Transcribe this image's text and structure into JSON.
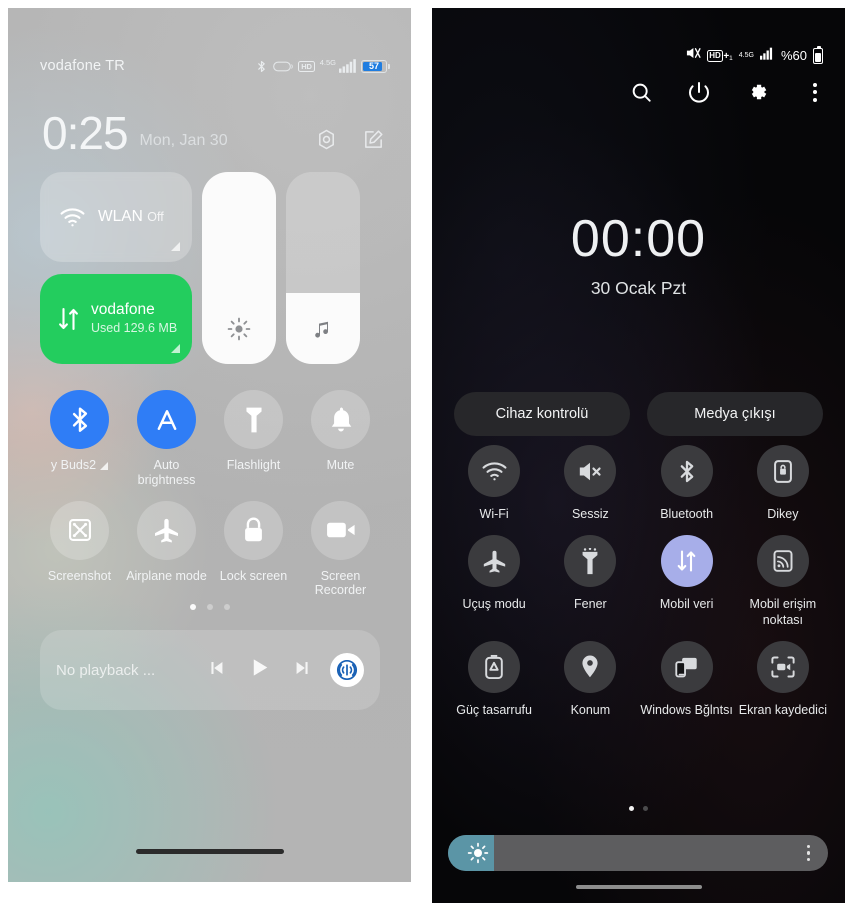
{
  "left": {
    "status": {
      "carrier": "vodafone TR",
      "icons": [
        "bluetooth-icon",
        "capsule-icon",
        "hd-icon"
      ],
      "hd": "HD",
      "network": "4.5G",
      "battery_percent": "57"
    },
    "clock": {
      "time": "0:25",
      "date": "Mon, Jan 30"
    },
    "clock_actions": [
      "settings-icon",
      "edit-icon"
    ],
    "tiles": [
      {
        "name": "wlan",
        "title": "WLAN",
        "sub": "Off",
        "active": false,
        "icon": "wifi-icon"
      },
      {
        "name": "mobile-data",
        "title": "vodafone",
        "sub": "Used 129.6 MB",
        "active": true,
        "icon": "data-arrows-icon"
      }
    ],
    "sliders": [
      {
        "name": "brightness",
        "icon": "sun-icon",
        "value": 100
      },
      {
        "name": "volume",
        "icon": "music-note-icon",
        "value": 37
      }
    ],
    "toggles": [
      {
        "label": "y Buds2",
        "icon": "bluetooth-icon",
        "active": true,
        "truncated": true,
        "arrow": true
      },
      {
        "label": "Auto brightness",
        "icon": "auto-brightness-icon",
        "active": true,
        "truncated": false,
        "arrow": false
      },
      {
        "label": "Flashlight",
        "icon": "flashlight-icon",
        "active": false,
        "truncated": false,
        "arrow": false
      },
      {
        "label": "Mute",
        "icon": "bell-icon",
        "active": false,
        "truncated": false,
        "arrow": false
      },
      {
        "label": "Screenshot",
        "icon": "screenshot-icon",
        "active": false,
        "truncated": false,
        "arrow": false
      },
      {
        "label": "Airplane mode",
        "icon": "airplane-icon",
        "active": false,
        "truncated": false,
        "arrow": false
      },
      {
        "label": "Lock screen",
        "icon": "lock-icon",
        "active": false,
        "truncated": false,
        "arrow": false
      },
      {
        "label": "Screen Recorder",
        "icon": "video-camera-icon",
        "active": false,
        "truncated": false,
        "arrow": false
      }
    ],
    "page_dots": {
      "count": 3,
      "active": 0
    },
    "media": {
      "title": "No playback ...",
      "controls": [
        "previous-icon",
        "play-icon",
        "next-icon"
      ],
      "cast_label": "cast-icon"
    }
  },
  "right": {
    "status": {
      "mute_icon": "mute-icon",
      "hd": "HD",
      "hd_plus": "+",
      "hd_sub": "1",
      "network": "4.5G",
      "battery_text": "%60"
    },
    "actions": [
      {
        "name": "search",
        "icon": "search-icon"
      },
      {
        "name": "power",
        "icon": "power-icon"
      },
      {
        "name": "settings",
        "icon": "gear-icon"
      },
      {
        "name": "more",
        "icon": "kebab-icon"
      }
    ],
    "clock": {
      "time": "00:00",
      "date": "30 Ocak Pzt"
    },
    "pills": [
      {
        "label": "Cihaz kontrolü"
      },
      {
        "label": "Medya çıkışı"
      }
    ],
    "toggles": [
      {
        "label": "Wi-Fi",
        "icon": "wifi-icon",
        "active": false
      },
      {
        "label": "Sessiz",
        "icon": "mute-icon",
        "active": false
      },
      {
        "label": "Bluetooth",
        "icon": "bluetooth-icon",
        "active": false
      },
      {
        "label": "Dikey",
        "icon": "rotation-lock-icon",
        "active": false
      },
      {
        "label": "Uçuş modu",
        "icon": "airplane-icon",
        "active": false
      },
      {
        "label": "Fener",
        "icon": "flashlight-icon",
        "active": false
      },
      {
        "label": "Mobil veri",
        "icon": "data-arrows-icon",
        "active": true
      },
      {
        "label": "Mobil erişim noktası",
        "icon": "hotspot-icon",
        "active": false
      },
      {
        "label": "Güç tasarrufu",
        "icon": "power-saving-icon",
        "active": false
      },
      {
        "label": "Konum",
        "icon": "location-pin-icon",
        "active": false
      },
      {
        "label": "Windows Bğlntsı",
        "icon": "windows-link-icon",
        "active": false
      },
      {
        "label": "Ekran kaydedici",
        "icon": "screen-recorder-icon",
        "active": false
      }
    ],
    "page_dots": {
      "count": 2,
      "active": 0
    },
    "brightness": {
      "value": 12,
      "icon": "sun-icon",
      "more_icon": "kebab-icon"
    }
  },
  "colors": {
    "accent_blue": "#2f7df6",
    "accent_green": "#23cd5e",
    "accent_periwinkle": "#a7aee9",
    "accent_teal": "#5b95a6",
    "battery_blue": "#1f7de0"
  }
}
